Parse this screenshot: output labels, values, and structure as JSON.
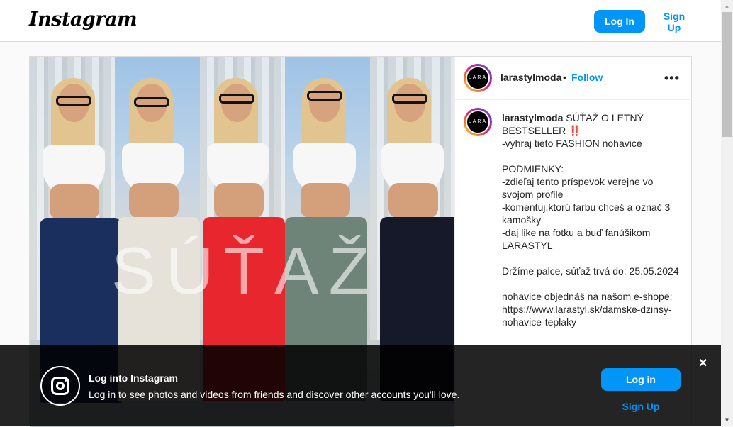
{
  "header": {
    "logo_text": "Instagram",
    "login_label": "Log In",
    "signup_label": "Sign Up"
  },
  "post": {
    "photo_overlay_text": "SÚŤAŽ",
    "username": "larastylmoda",
    "separator": "•",
    "follow_label": "Follow",
    "more_icon": "more-options-icon",
    "avatar_text": "LARA",
    "caption_username": "larastylmoda",
    "caption_text": " SÚŤAŽ O LETNÝ BESTSELLER ‼️\n-vyhraj tieto FASHION nohavice\n\nPODMIENKY:\n-zdieľaj tento príspevok verejne vo svojom profile\n-komentuj,ktorú farbu chceš a označ 3 kamošky\n-daj like na fotku a buď fanúšikom LARASTYL\n\nDržíme palce, súťaž trvá do: 25.05.2024\n\nnohavice objednáš na našom e-shope: https://www.larastyl.sk/damske-dzinsy-nohavice-teplaky"
  },
  "banner": {
    "title": "Log into Instagram",
    "text": "Log in to see photos and videos from friends and discover other accounts you'll love.",
    "login_label": "Log in",
    "signup_label": "Sign Up",
    "close_glyph": "✕"
  },
  "colors": {
    "accent": "#0095f6",
    "pants": [
      "#1b2f5e",
      "#e6e2da",
      "#e8262e",
      "#6f8478",
      "#15192a"
    ]
  }
}
